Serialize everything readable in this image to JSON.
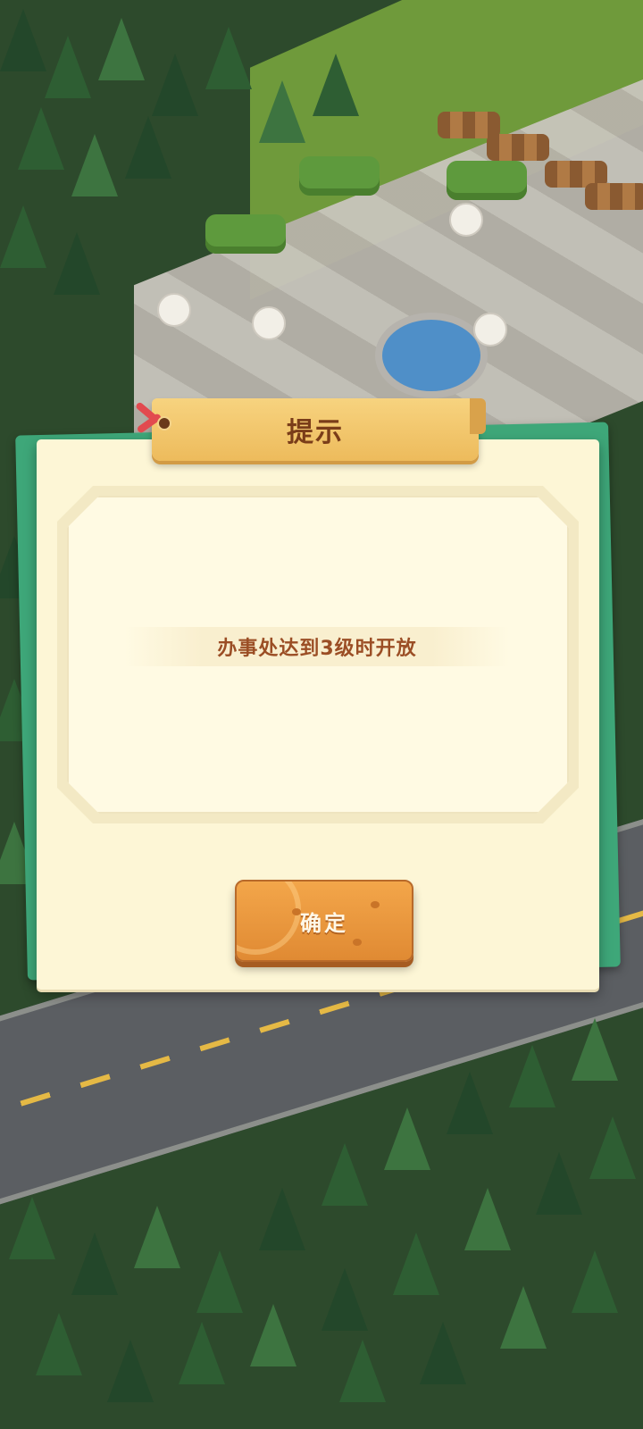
{
  "dialog": {
    "title": "提示",
    "message": "办事处达到3级时开放",
    "confirm_label": "确定"
  },
  "colors": {
    "dialog_background": "#fdf6d6",
    "dialog_back_card": "#3ea779",
    "title_banner": "#f2c56b",
    "title_text": "#7a3d19",
    "message_text": "#9b4e25",
    "confirm_button": "#e8943a"
  }
}
